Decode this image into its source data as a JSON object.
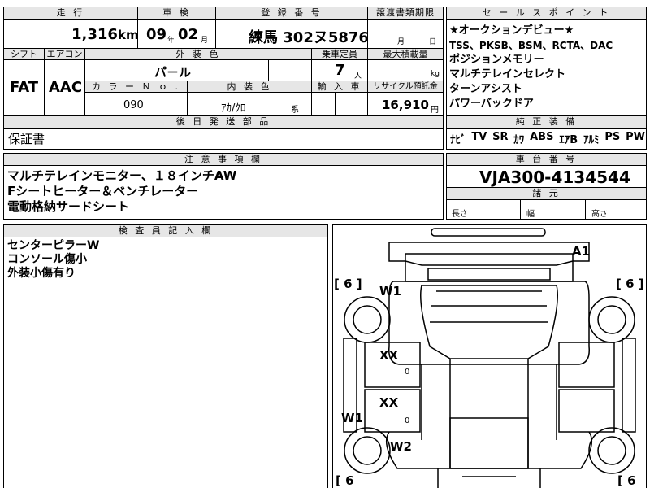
{
  "top": {
    "headers": {
      "mileage": "走 行",
      "shaken": "車 検",
      "registration": "登 録 番 号",
      "transfer_deadline": "譲渡書類期限",
      "sales_points": "セ ー ル ス ポ イ ン ト"
    },
    "mileage_value": "1,316",
    "mileage_unit": "km",
    "shaken_year": "09",
    "shaken_year_unit": "年",
    "shaken_month": "02",
    "shaken_month_unit": "月",
    "registration_value": "練馬 302ヌ5876",
    "deadline_month": "月",
    "deadline_day": "日"
  },
  "row2": {
    "shift_label": "シフト",
    "ac_label": "エアコン",
    "exterior_color_label": "外 装 色",
    "capacity_label": "乗車定員",
    "max_load_label": "最大積載量",
    "shift_value": "FAT",
    "ac_value": "AAC",
    "exterior_color_value": "パ－ル",
    "capacity_value": "7",
    "capacity_unit": "人",
    "max_load_unit": "kg",
    "color_no_label": "カ ラ ー Ｎ ｏ .",
    "interior_label": "内 装 色",
    "import_label": "輸 入 車",
    "recycle_label": "リサイクル預託金",
    "color_no_value": "090",
    "interior_value": "ｱｶ/ｸﾛ",
    "interior_suffix": "系",
    "recycle_value": "16,910",
    "recycle_unit": "円"
  },
  "sales_points": [
    "★オークションデビュー★",
    "TSS、PKSB、BSM、RCTA、DAC",
    "ポジションメモリー",
    "マルチテレインセレクト",
    "ターンアシスト",
    "パワーバックドア"
  ],
  "equipment": {
    "label": "純 正 装 備",
    "items": [
      "ﾅﾋﾞ",
      "TV",
      "SR",
      "ｶﾜ",
      "ABS",
      "ｴｱB",
      "ｱﾙﾐ",
      "PS",
      "PW"
    ]
  },
  "later_parts": {
    "label": "後 日 発 送 部 品",
    "value": "保証書"
  },
  "notes": {
    "label": "注 意 事 項 欄",
    "lines": [
      "マルチテレインモニター、１８インチAW",
      "Fシートヒーター＆ベンチレーター",
      "電動格納サードシート"
    ]
  },
  "chassis": {
    "label": "車 台 番 号",
    "value": "VJA300-4134544",
    "dims_label": "諸 元",
    "length": "長さ",
    "width": "幅",
    "height": "高さ"
  },
  "inspector": {
    "label": "検 査 員 記 入 欄",
    "lines": [
      "センターピラーW",
      "コンソール傷小",
      "外装小傷有り"
    ]
  },
  "diagram": {
    "tire_left_top": "[ 6 ]",
    "tire_right_top": "[ 6 ]",
    "tire_left_bottom": "[ 6",
    "tire_right_bottom": "[ 6",
    "mark_a1": "A1",
    "mark_w1_top": "W1",
    "mark_xx_1": "XX",
    "mark_0_1": "0",
    "mark_xx_2": "XX",
    "mark_0_2": "0",
    "mark_w1_side": "W1",
    "mark_w2": "W2"
  }
}
